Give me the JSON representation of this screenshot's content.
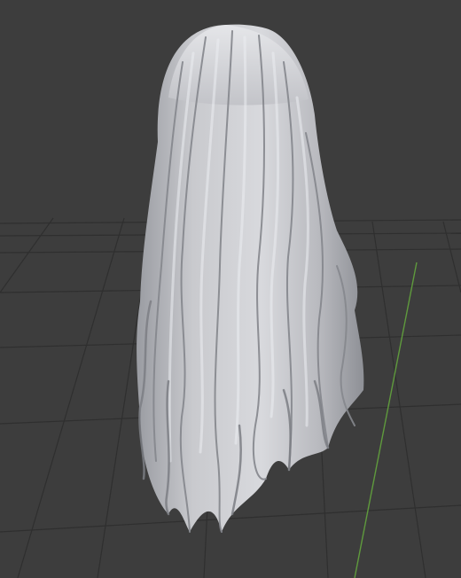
{
  "viewport": {
    "mode": "Solid",
    "object": "hair-mesh",
    "background_color": "#3d3d3d",
    "grid_color": "#2f2f2f",
    "y_axis_color": "#5f9a3d",
    "shading_color": "#c8c9cd",
    "highlight_color": "#eceef2",
    "shadow_color": "#7c7e84"
  }
}
